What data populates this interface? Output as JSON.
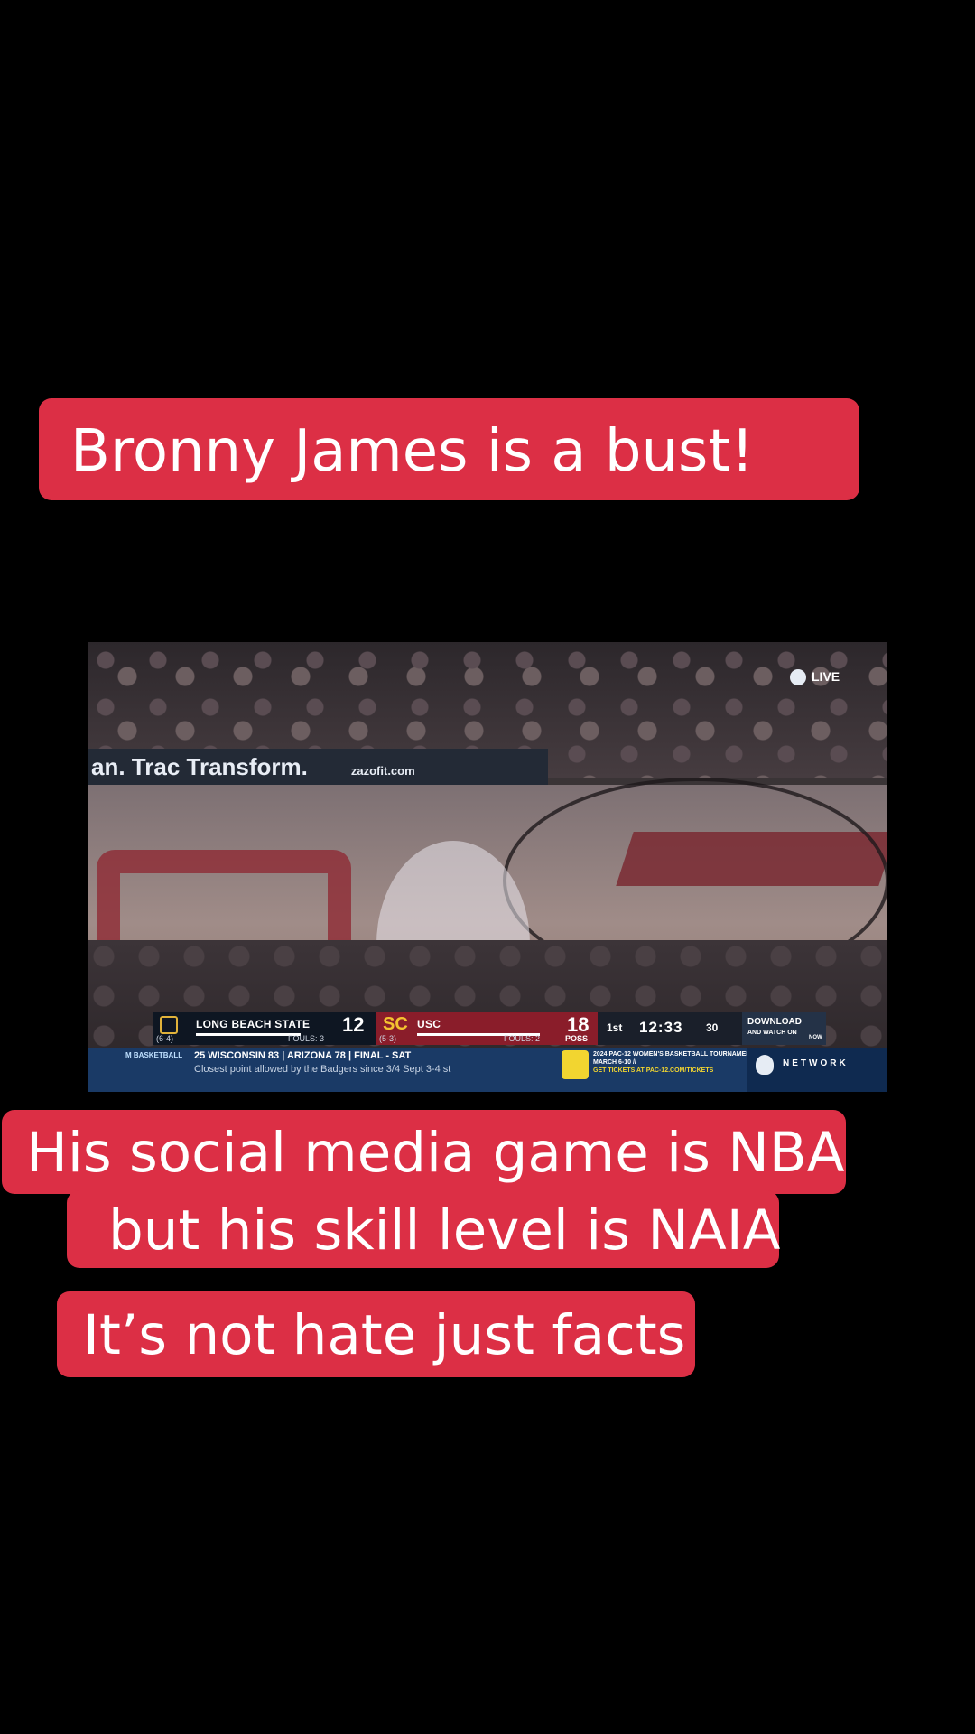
{
  "captions": {
    "top": "Bronny James is a bust!",
    "line1": "His social media game is NBA",
    "line2": "but his skill level is NAIA",
    "bottom": "It’s not hate just facts"
  },
  "video": {
    "live_label": "LIVE",
    "ad_text": "an. Trac  Transform.",
    "ad_url": "zazofit.com",
    "scoreboard": {
      "team1_name": "LONG BEACH STATE",
      "team1_record": "(6-4)",
      "team1_score": "12",
      "team1_fouls": "FOULS: 3",
      "team2_name": "USC",
      "team2_record": "(5-3)",
      "team2_score": "18",
      "team2_fouls": "FOULS: 2",
      "team2_poss": "POSS",
      "period": "1st",
      "clock": "12:33",
      "shot_clock": "30",
      "download_line1": "DOWNLOAD",
      "download_line2": "AND WATCH ON",
      "download_line3": "NOW"
    },
    "ticker": {
      "category": "M BASKETBALL",
      "score_line": "25 WISCONSIN  83  |  ARIZONA  78  |  FINAL - SAT",
      "sub_line": "Closest point allowed by the Badgers since 3/4 Sept 3-4 st",
      "promo_line1": "2024 PAC-12 WOMEN'S BASKETBALL TOURNAMENT",
      "promo_line2": "MARCH 6-10 //",
      "promo_line3": "GET TICKETS AT PAC-12.COM/TICKETS",
      "network": "NETWORK"
    }
  }
}
